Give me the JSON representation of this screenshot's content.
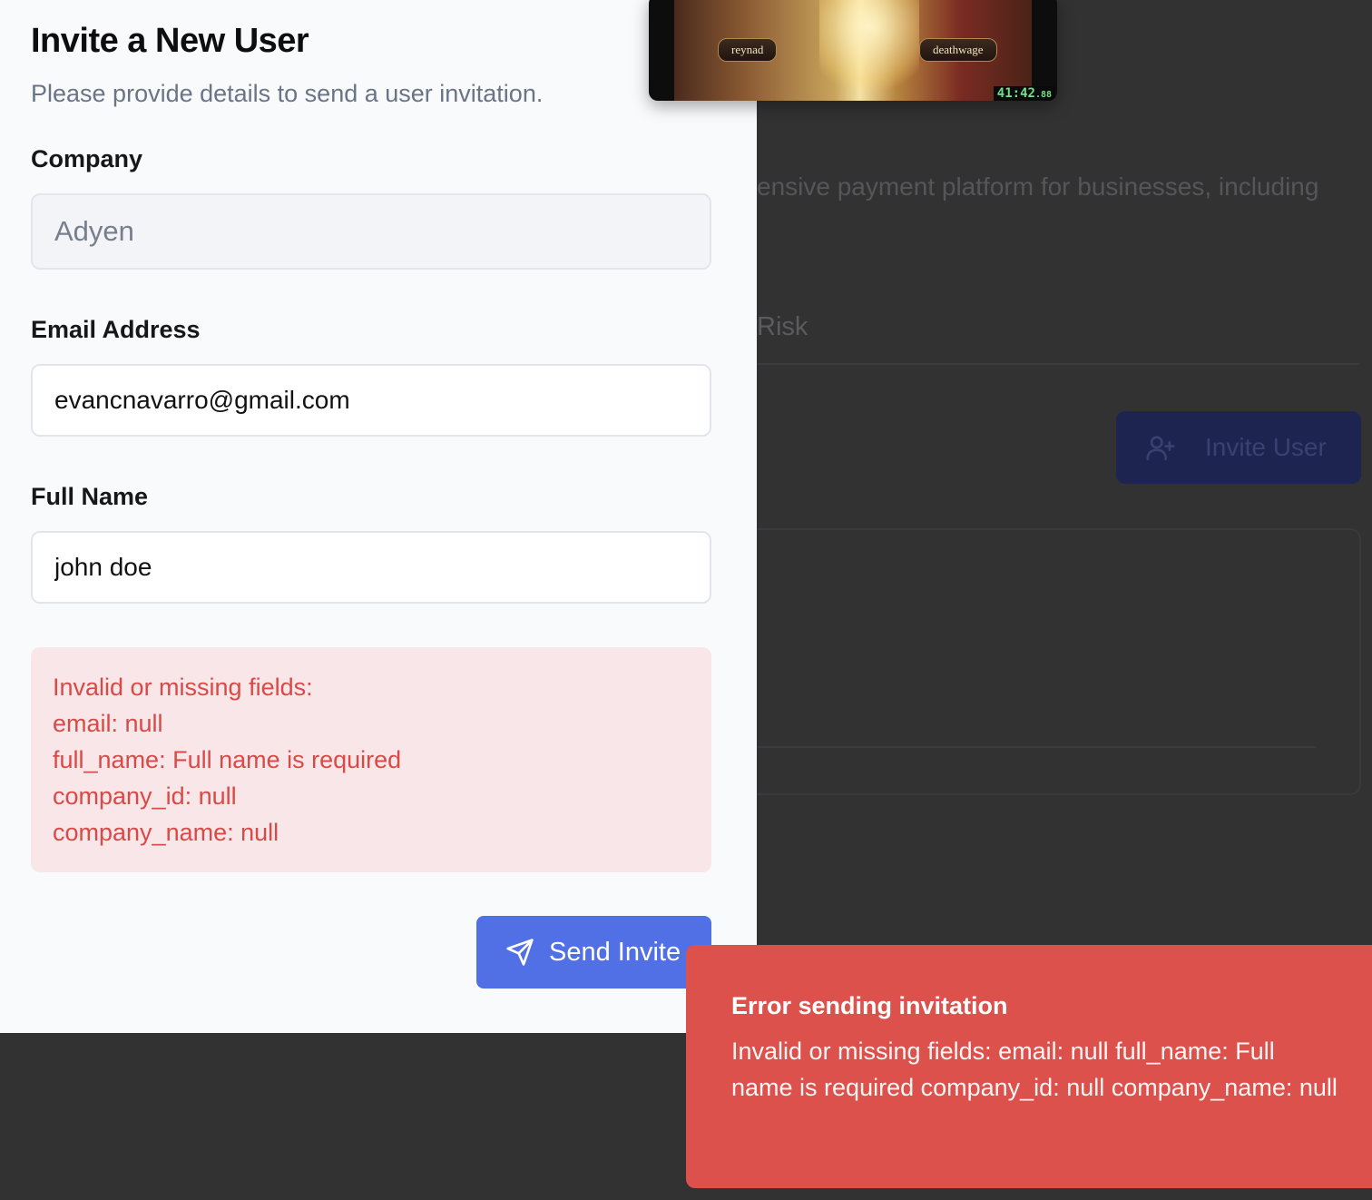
{
  "background": {
    "description_fragment": "ensive payment platform for businesses, including",
    "tab_fragment": "Risk",
    "invite_button_label": "Invite User",
    "invite_button_icon": "user-plus-icon"
  },
  "modal": {
    "title": "Invite a New User",
    "subtitle": "Please provide details to send a user invitation.",
    "company": {
      "label": "Company",
      "value": "Adyen"
    },
    "email": {
      "label": "Email Address",
      "value": "evancnavarro@gmail.com"
    },
    "full_name": {
      "label": "Full Name",
      "value": "john doe"
    },
    "errors": {
      "lines": [
        "Invalid or missing fields:",
        "email: null",
        "full_name: Full name is required",
        "company_id: null",
        "company_name: null"
      ]
    },
    "send_button": {
      "label": "Send Invite",
      "icon": "send-icon"
    }
  },
  "video_overlay": {
    "player_left": "reynad",
    "player_right": "deathwage",
    "timer": "41:42",
    "timer_fraction": ".88"
  },
  "toast": {
    "title": "Error sending invitation",
    "message": "Invalid or missing fields: email: null full_name: Full name is required company_id: null company_name: null"
  },
  "colors": {
    "primary": "#5270e6",
    "error_text": "#d94a46",
    "error_bg": "#f9e6e9",
    "toast_bg": "#dc514c"
  }
}
